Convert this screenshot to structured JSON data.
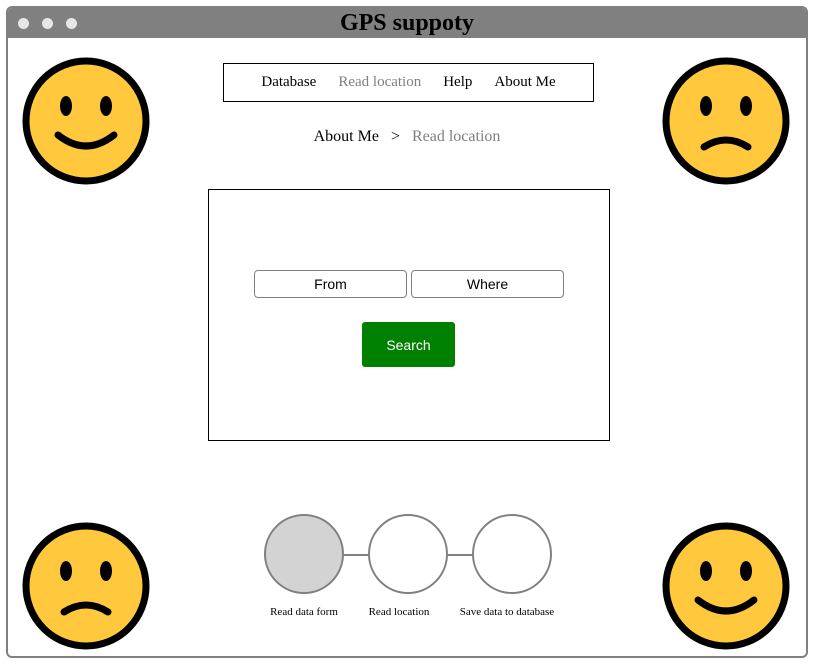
{
  "window": {
    "title": "GPS suppoty"
  },
  "nav": {
    "items": [
      {
        "label": "Database"
      },
      {
        "label": "Read location"
      },
      {
        "label": "Help"
      },
      {
        "label": "About Me"
      }
    ]
  },
  "breadcrumb": {
    "home": "About Me",
    "separator": ">",
    "current": "Read location"
  },
  "search_form": {
    "from_placeholder": "From",
    "where_placeholder": "Where",
    "search_label": "Search"
  },
  "steps": [
    {
      "label": "Read data form",
      "state": "active"
    },
    {
      "label": "Read location",
      "state": "inactive"
    },
    {
      "label": "Save data to database",
      "state": "inactive"
    }
  ],
  "faces": {
    "top_left": "happy-face-icon",
    "top_right": "sad-face-icon",
    "bottom_left": "sad-face-icon",
    "bottom_right": "happy-face-icon"
  },
  "colors": {
    "titlebar": "#808080",
    "search_button": "#008000",
    "face_fill": "#FFC83D",
    "active_step": "#D3D3D3"
  }
}
